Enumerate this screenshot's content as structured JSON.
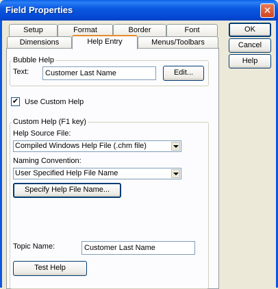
{
  "window": {
    "title": "Field Properties",
    "close_glyph": "✕"
  },
  "buttons": {
    "ok": "OK",
    "cancel": "Cancel",
    "help": "Help"
  },
  "tabs": {
    "row1": [
      "Setup",
      "Format",
      "Border",
      "Font"
    ],
    "row2": [
      "Dimensions",
      "Help Entry",
      "Menus/Toolbars"
    ],
    "active": "Help Entry"
  },
  "bubble_help": {
    "group_label": "Bubble Help",
    "text_label": "Text:",
    "text_value": "Customer Last Name",
    "edit_button": "Edit..."
  },
  "use_custom_help": {
    "label": "Use Custom Help",
    "checked": true,
    "check_glyph": "✔"
  },
  "custom_help": {
    "group_label": "Custom Help (F1 key)",
    "source_label": "Help Source File:",
    "source_value": "Compiled Windows Help File (.chm file)",
    "naming_label": "Naming Convention:",
    "naming_value": "User Specified Help File Name",
    "specify_button": "Specify Help File Name...",
    "topic_label": "Topic Name:",
    "topic_value": "Customer Last Name",
    "test_button": "Test Help"
  }
}
